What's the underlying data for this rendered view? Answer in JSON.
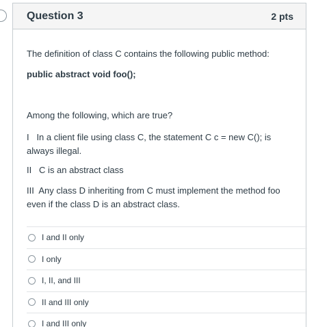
{
  "question": {
    "title": "Question 3",
    "points": "2 pts",
    "paragraphs": {
      "intro": "The definition of class C contains the following public method:",
      "code": "public abstract void foo();",
      "prompt": "Among the following, which are true?",
      "s1": "I   In a client file using class C, the statement C c = new C(); is always illegal.",
      "s2": "II   C is an abstract class",
      "s3": "III  Any class D inheriting from C must implement the method foo even if the class D is an abstract class."
    },
    "options": [
      {
        "label": "I and II only"
      },
      {
        "label": "I only"
      },
      {
        "label": "I, II, and III"
      },
      {
        "label": "II and III only"
      },
      {
        "label": "I and III only"
      }
    ]
  }
}
